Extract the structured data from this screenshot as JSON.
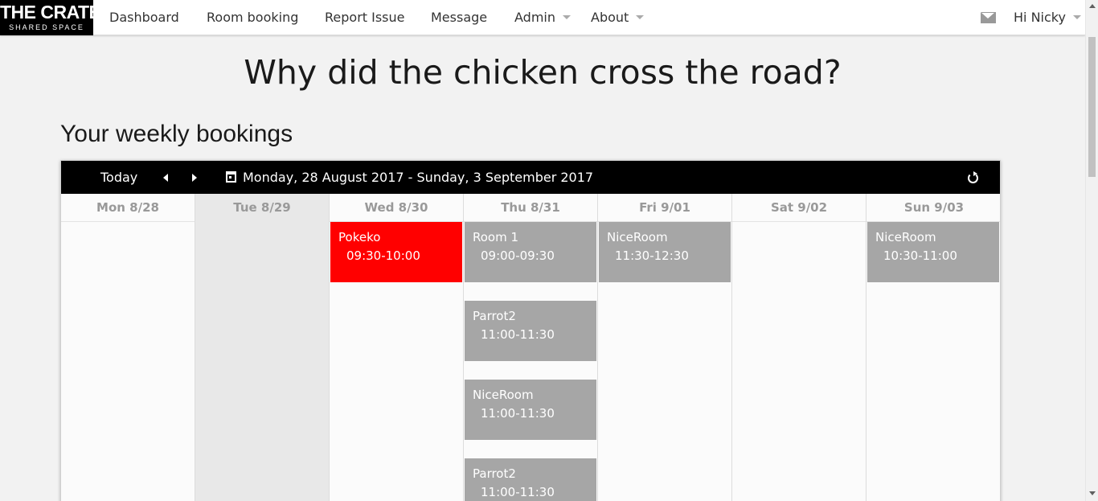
{
  "logo": {
    "main": "THE CRATE",
    "sub": "SHARED SPACE"
  },
  "nav": {
    "dashboard": "Dashboard",
    "room_booking": "Room booking",
    "report_issue": "Report Issue",
    "message": "Message",
    "admin": "Admin",
    "about": "About",
    "greeting": "Hi Nicky"
  },
  "headline": "Why did the chicken cross the road?",
  "section_title": "Your weekly bookings",
  "calendar": {
    "today_label": "Today",
    "range_label": "Monday, 28 August 2017 - Sunday, 3 September 2017",
    "days": [
      "Mon 8/28",
      "Tue 8/29",
      "Wed 8/30",
      "Thu 8/31",
      "Fri 9/01",
      "Sat 9/02",
      "Sun 9/03"
    ],
    "events": {
      "wed_1": {
        "title": "Pokeko",
        "time": "09:30-10:00",
        "color": "#ff0000"
      },
      "thu_1": {
        "title": "Room 1",
        "time": "09:00-09:30",
        "color": "#a6a6a6"
      },
      "thu_2": {
        "title": "Parrot2",
        "time": "11:00-11:30",
        "color": "#a6a6a6"
      },
      "thu_3": {
        "title": "NiceRoom",
        "time": "11:00-11:30",
        "color": "#a6a6a6"
      },
      "thu_4": {
        "title": "Parrot2",
        "time": "11:00-11:30",
        "color": "#a6a6a6"
      },
      "fri_1": {
        "title": "NiceRoom",
        "time": "11:30-12:30",
        "color": "#a6a6a6"
      },
      "sun_1": {
        "title": "NiceRoom",
        "time": "10:30-11:00",
        "color": "#a6a6a6"
      }
    }
  },
  "icons": [
    "mail-icon",
    "refresh-icon",
    "calendar-icon",
    "chevron-left-icon",
    "chevron-right-icon"
  ]
}
